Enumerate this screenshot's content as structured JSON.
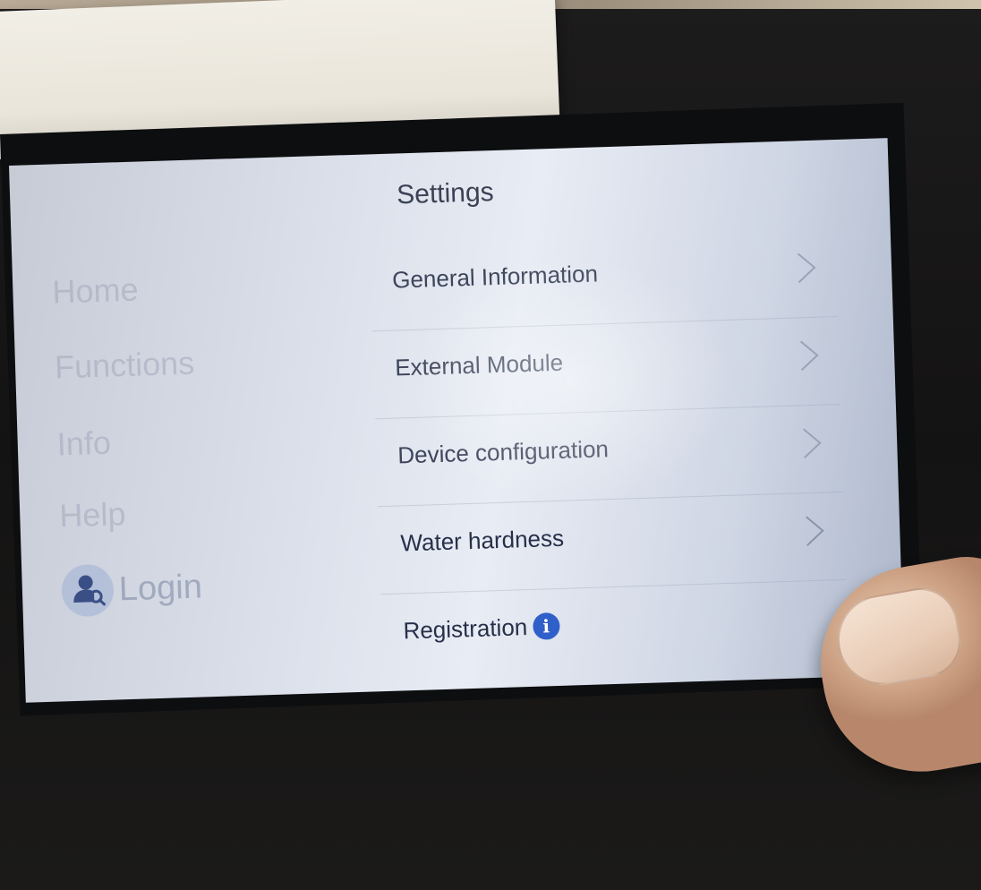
{
  "screen": {
    "title": "Settings",
    "sidebar": {
      "items": [
        {
          "label": "Home"
        },
        {
          "label": "Functions"
        },
        {
          "label": "Info"
        },
        {
          "label": "Help"
        }
      ],
      "login_label": "Login",
      "login_icon": "user-search-icon"
    },
    "menu": {
      "items": [
        {
          "label": "General Information",
          "icon": "chevron-right-icon"
        },
        {
          "label": "External Module",
          "icon": "chevron-right-icon"
        },
        {
          "label": "Device configuration",
          "icon": "chevron-right-icon"
        },
        {
          "label": "Water hardness",
          "icon": "chevron-right-icon"
        },
        {
          "label": "Registration",
          "badge": "i",
          "badge_icon": "info-icon"
        }
      ]
    },
    "colors": {
      "accent": "#2f5fc9",
      "screen_background": "#dde2ec",
      "text": "#3c455a"
    }
  }
}
